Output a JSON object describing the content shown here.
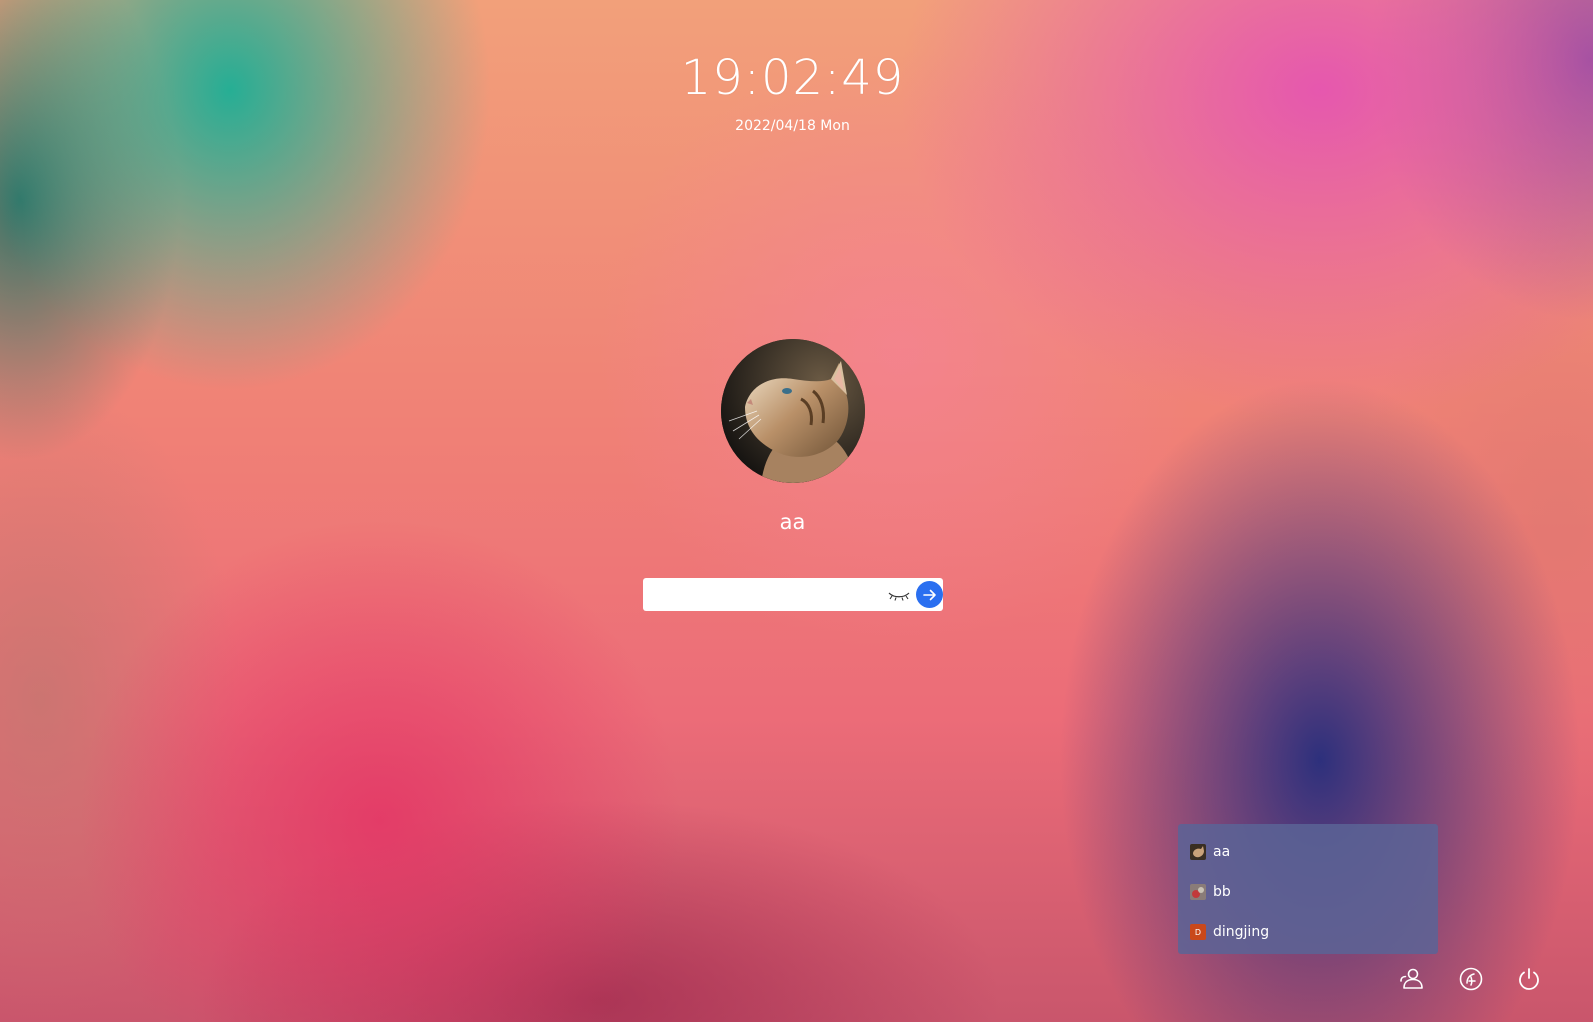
{
  "clock": {
    "time": "19:02:49",
    "date": "2022/04/18 Mon"
  },
  "login": {
    "username": "aa",
    "password_value": "",
    "eye_icon": "eye-closed-icon",
    "submit_icon": "arrow-right-icon",
    "accent_color": "#2a6ff0"
  },
  "user_list": {
    "items": [
      {
        "label": "aa",
        "avatar": "cat-avatar"
      },
      {
        "label": "bb",
        "avatar": "photo-avatar"
      },
      {
        "label": "dingjing",
        "avatar": "letter-avatar",
        "avatar_letter": "D",
        "avatar_color": "#c9481a"
      }
    ]
  },
  "corner_buttons": [
    {
      "name": "switch-user",
      "icon": "users-icon"
    },
    {
      "name": "keyboard-layout",
      "icon": "keyboard-icon"
    },
    {
      "name": "power",
      "icon": "power-icon"
    }
  ]
}
